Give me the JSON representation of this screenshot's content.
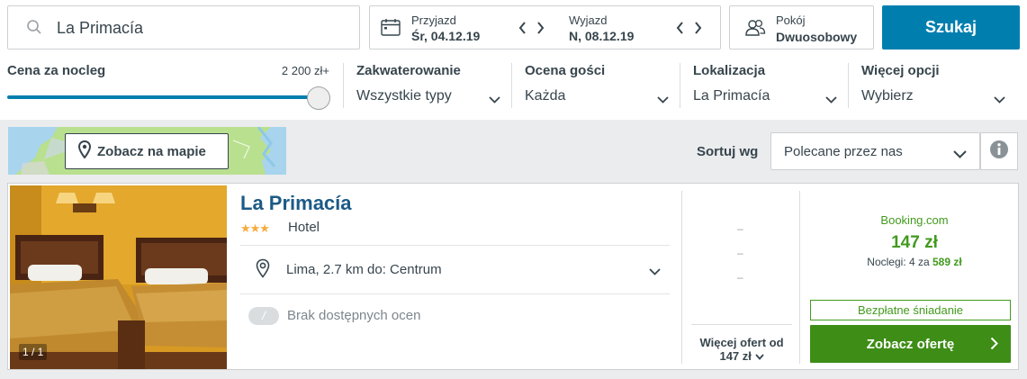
{
  "search": {
    "destination": "La Primacía",
    "button_label": "Szukaj"
  },
  "dates": {
    "checkin_label": "Przyjazd",
    "checkin_value": "Śr, 04.12.19",
    "checkout_label": "Wyjazd",
    "checkout_value": "N, 08.12.19"
  },
  "room": {
    "label": "Pokój",
    "value": "Dwuosobowy"
  },
  "filters": {
    "price": {
      "label": "Cena za nocleg",
      "max": "2 200 zł+",
      "fill_fraction": 1.0
    },
    "accommodation": {
      "label": "Zakwaterowanie",
      "value": "Wszystkie typy"
    },
    "rating": {
      "label": "Ocena gości",
      "value": "Każda"
    },
    "location": {
      "label": "Lokalizacja",
      "value": "La Primacía"
    },
    "more": {
      "label": "Więcej opcji",
      "value": "Wybierz"
    }
  },
  "map": {
    "button_label": "Zobacz na mapie"
  },
  "sort": {
    "label": "Sortuj wg",
    "value": "Polecane przez nas"
  },
  "result": {
    "name": "La Primacía",
    "stars": "★★★",
    "star_count": 3,
    "type": "Hotel",
    "location": "Lima, 2.7 km do: Centrum",
    "rating_badge": "/",
    "rating_text": "Brak dostępnych ocen",
    "photo_counter": "1 / 1",
    "dashes": [
      "–",
      "–",
      "–"
    ],
    "more_offers_line1": "Więcej ofert od",
    "more_offers_line2": "147 zł",
    "provider": "Booking.com",
    "price": "147 zł",
    "nights_prefix": "Noclegi: 4 za",
    "nights_total": "589 zł",
    "breakfast": "Bezpłatne śniadanie",
    "deal_button": "Zobacz ofertę"
  },
  "colors": {
    "primary": "#007faf",
    "deal_green": "#3e8d16",
    "price_green": "#429a1e",
    "hotel_name": "#1c5a86",
    "star": "#f6ab3f"
  }
}
